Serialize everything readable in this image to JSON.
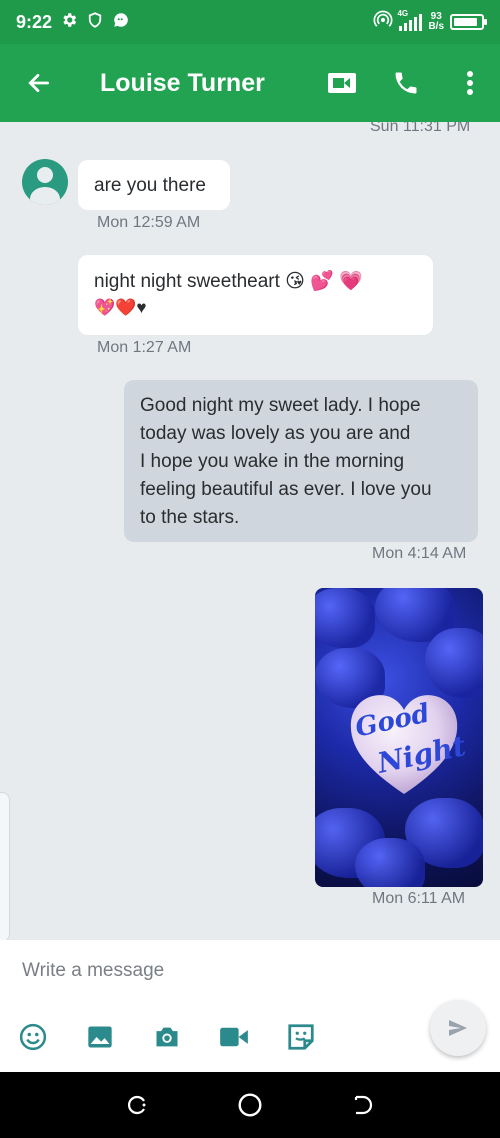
{
  "status_bar": {
    "time": "9:22",
    "network_type": "4G",
    "net_speed_value": "93",
    "net_speed_unit": "B/s",
    "battery_level": 0.9,
    "icons": [
      "settings-icon",
      "shield-icon",
      "chat-notification-icon",
      "hotspot-icon",
      "signal-icon",
      "battery-icon"
    ]
  },
  "app_bar": {
    "contact_name": "Louise Turner",
    "icons": [
      "back-arrow-icon",
      "video-call-icon",
      "phone-icon",
      "more-vert-icon"
    ]
  },
  "conversation": {
    "top_partial_timestamp": "Sun 11:31 PM",
    "messages": [
      {
        "direction": "incoming",
        "text": "are you there",
        "timestamp": "Mon 12:59 AM"
      },
      {
        "direction": "incoming",
        "text": "night night sweetheart 😘 💕 💗",
        "text_line2": "💖❤️♥",
        "timestamp": "Mon 1:27 AM"
      },
      {
        "direction": "outgoing",
        "lines": [
          "Good night my sweet lady. I hope",
          "today was lovely as you are and",
          "I hope you wake in the morning",
          "feeling beautiful as ever. I love you",
          "to the stars."
        ],
        "timestamp": "Mon 4:14 AM"
      },
      {
        "direction": "outgoing",
        "type": "image",
        "image_text_1": "Good",
        "image_text_2": "Night",
        "timestamp": "Mon 6:11 AM"
      }
    ]
  },
  "composer": {
    "placeholder": "Write a message",
    "tools": [
      "emoji-icon",
      "gallery-icon",
      "camera-icon",
      "video-icon",
      "sticker-icon"
    ],
    "send_icon": "send-icon"
  },
  "colors": {
    "status_bar": "#1e9a4a",
    "app_bar": "#22a352",
    "chat_background": "#e8ebee",
    "incoming_bubble": "#ffffff",
    "outgoing_bubble": "#cfd6dd",
    "tool_icon": "#2a8a8c"
  }
}
